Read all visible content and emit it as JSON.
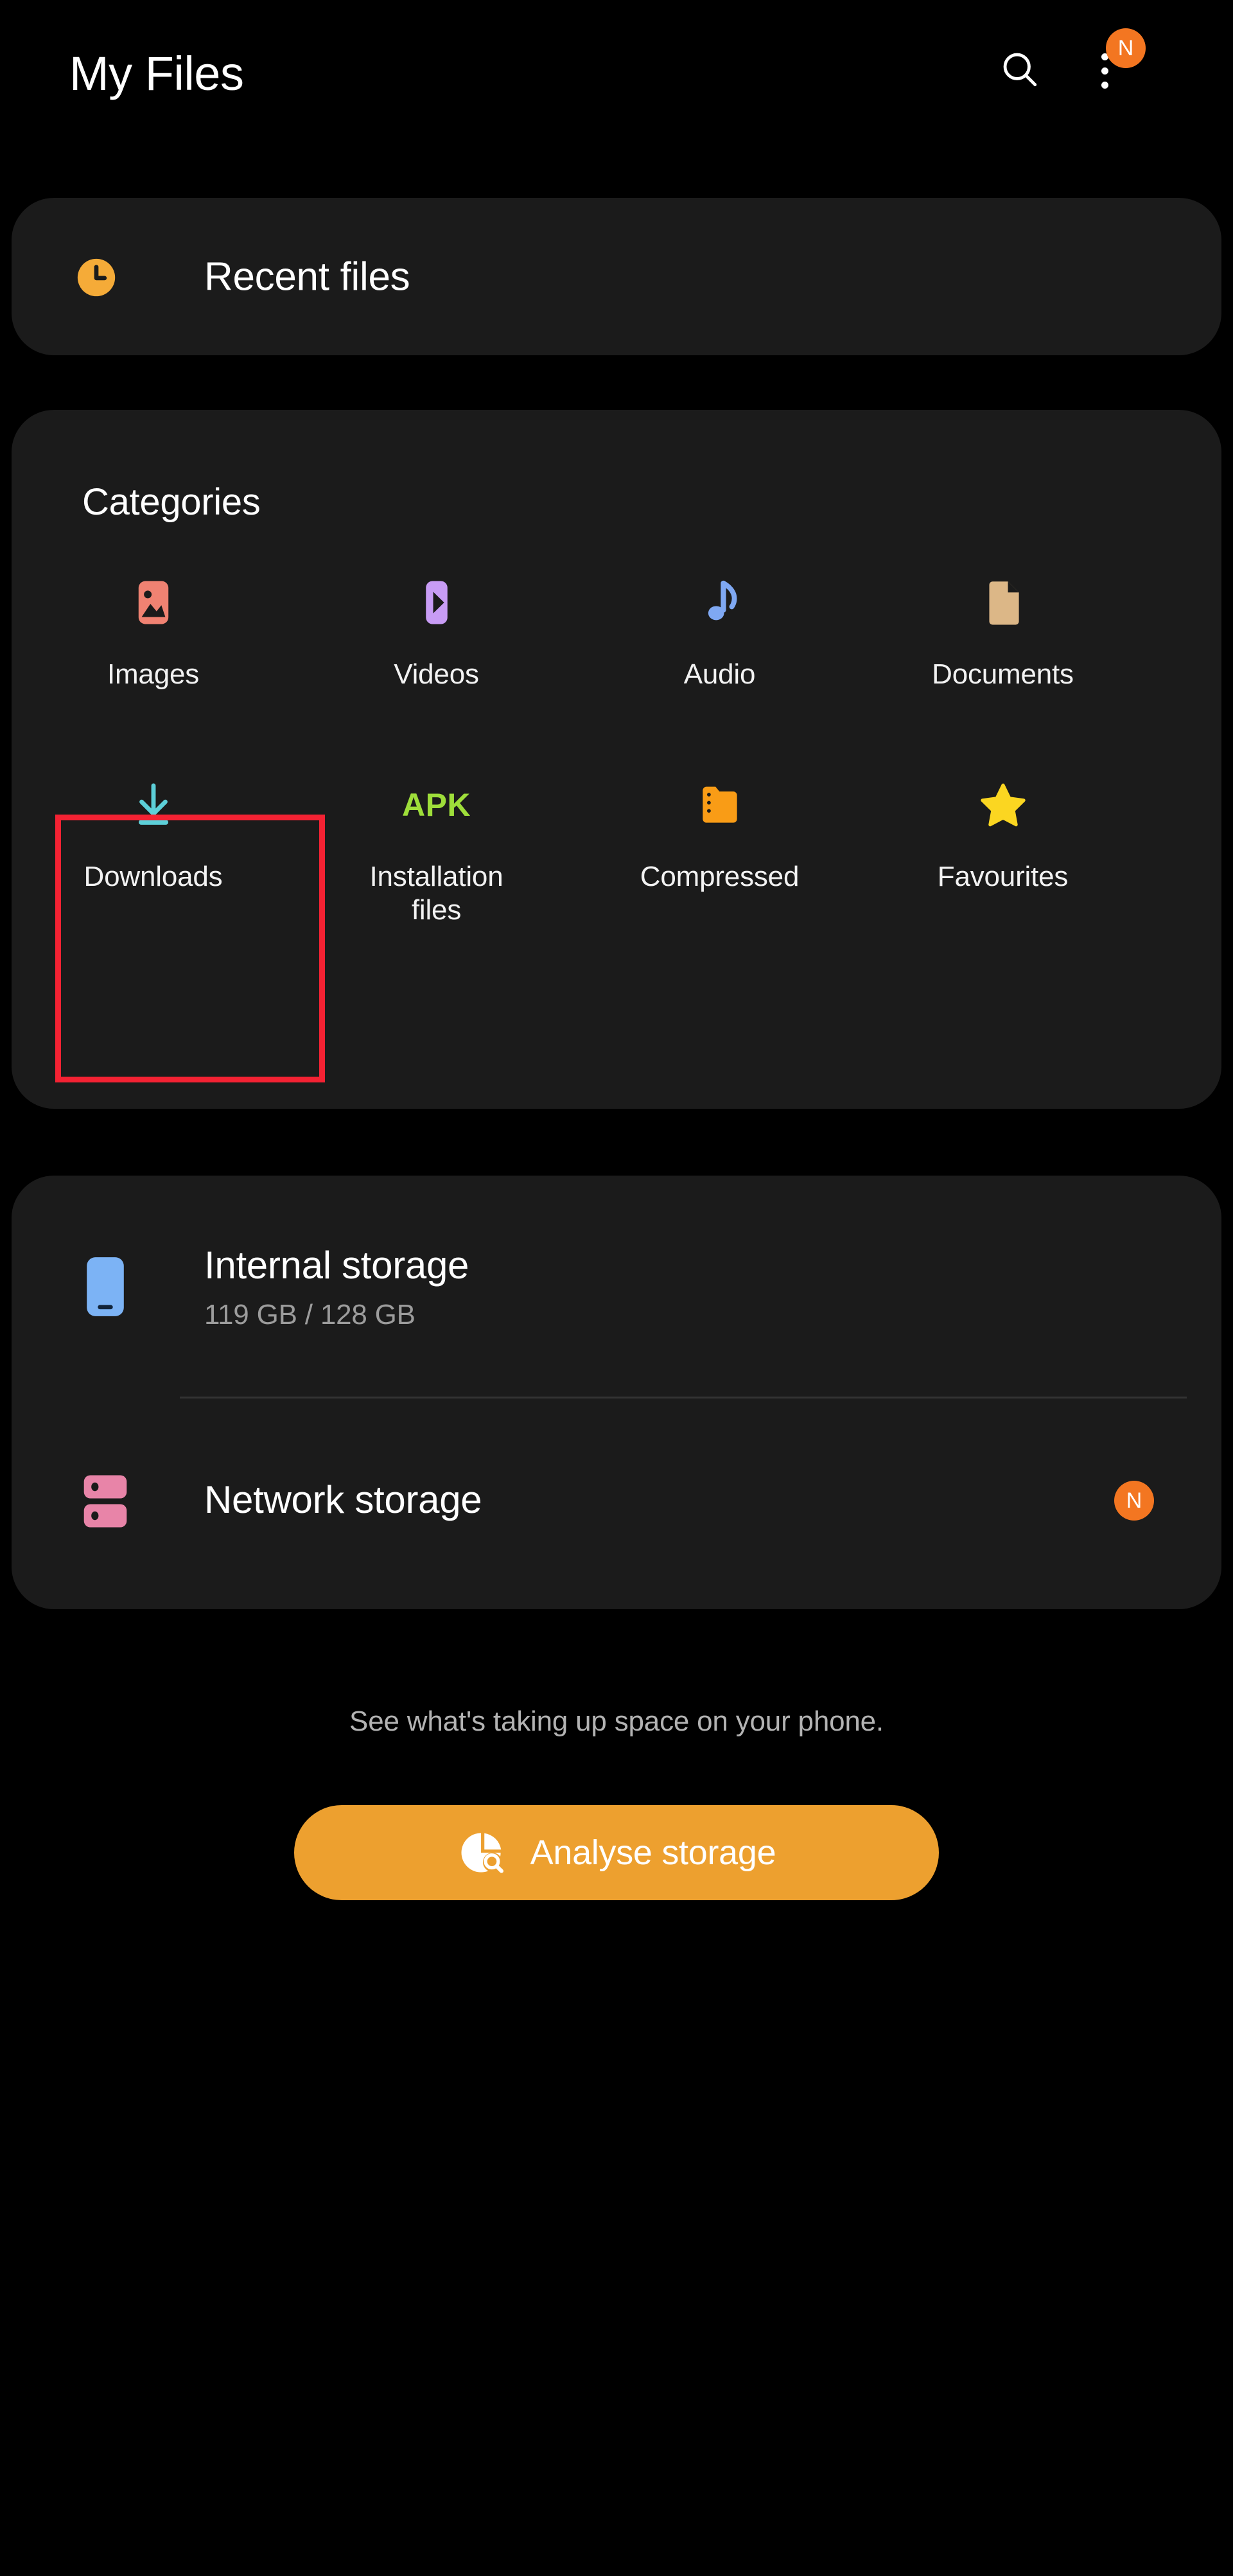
{
  "header": {
    "title": "My Files",
    "search_icon": "search-icon",
    "overflow_icon": "more-vertical-icon",
    "badge": "N"
  },
  "recent": {
    "label": "Recent files",
    "icon": "clock-icon",
    "icon_color": "#f5ab38"
  },
  "categories": {
    "title": "Categories",
    "items": [
      {
        "label": "Images",
        "icon": "image-icon",
        "color": "#f08272"
      },
      {
        "label": "Videos",
        "icon": "video-play-icon",
        "color": "#c89cf5"
      },
      {
        "label": "Audio",
        "icon": "music-note-icon",
        "color": "#7fa8f2"
      },
      {
        "label": "Documents",
        "icon": "document-icon",
        "color": "#dcb787"
      },
      {
        "label": "Downloads",
        "icon": "download-icon",
        "color": "#5ccfd8"
      },
      {
        "label": "Installation\nfiles",
        "icon": "apk-icon",
        "color": "#9ede3a",
        "glyph": "APK"
      },
      {
        "label": "Compressed",
        "icon": "zip-folder-icon",
        "color": "#f99c16"
      },
      {
        "label": "Favourites",
        "icon": "star-icon",
        "color": "#fbd621"
      }
    ],
    "highlighted_item": "Downloads",
    "highlight_color": "#f42233"
  },
  "storage": {
    "internal": {
      "title": "Internal storage",
      "subtitle": "119 GB / 128 GB",
      "icon": "phone-icon",
      "icon_color": "#7cb3f5"
    },
    "network": {
      "title": "Network storage",
      "icon": "server-icon",
      "icon_color": "#e884a8",
      "badge": "N"
    }
  },
  "footer": {
    "caption": "See what's taking up space on your phone.",
    "button_label": "Analyse storage",
    "button_icon": "pie-chart-search-icon",
    "button_color": "#eda02f"
  }
}
